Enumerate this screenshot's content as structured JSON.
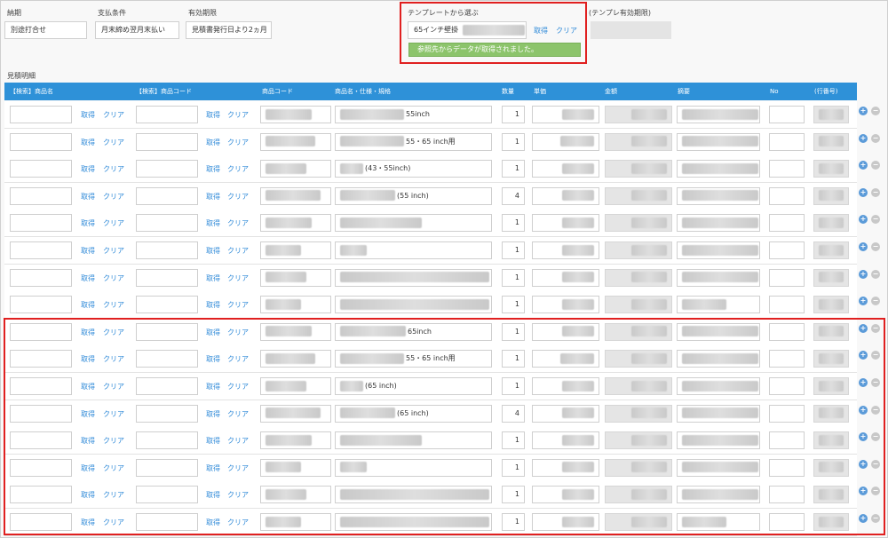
{
  "form": {
    "delivery": {
      "label": "納期",
      "value": "別途打合せ"
    },
    "payment": {
      "label": "支払条件",
      "value": "月末締め翌月末払い"
    },
    "validity": {
      "label": "有効期限",
      "value": "見積書発行日より2ヵ月"
    },
    "template": {
      "label": "テンプレートから選ぶ",
      "value": "65インチ壁掛",
      "get_label": "取得",
      "clear_label": "クリア",
      "success_message": "参照先からデータが取得されました。"
    },
    "template_validity": {
      "label": "(テンプレ有効期限)"
    }
  },
  "section_title": "見積明細",
  "table": {
    "headers": [
      "【検索】商品名",
      "【検索】商品コード",
      "商品コード",
      "商品名・仕様・規格",
      "数量",
      "単価",
      "金額",
      "摘要",
      "No",
      "(行番号)"
    ],
    "link_get": "取得",
    "link_clear": "クリア",
    "rows": [
      {
        "name_suffix": "55inch",
        "qty": "1"
      },
      {
        "name_suffix": "55・65 inch用",
        "qty": "1"
      },
      {
        "name_suffix": "(43・55inch)",
        "qty": "1"
      },
      {
        "name_suffix": "(55 inch)",
        "qty": "4"
      },
      {
        "name_suffix": "",
        "qty": "1"
      },
      {
        "name_suffix": "",
        "qty": "1"
      },
      {
        "name_suffix": "",
        "qty": "1"
      },
      {
        "name_suffix": "",
        "qty": "1"
      },
      {
        "name_suffix": "65inch",
        "qty": "1"
      },
      {
        "name_suffix": "55・65 inch用",
        "qty": "1"
      },
      {
        "name_suffix": "(65 inch)",
        "qty": "1"
      },
      {
        "name_suffix": "(65 inch)",
        "qty": "4"
      },
      {
        "name_suffix": "",
        "qty": "1"
      },
      {
        "name_suffix": "",
        "qty": "1"
      },
      {
        "name_suffix": "",
        "qty": "1"
      },
      {
        "name_suffix": "",
        "qty": "1"
      }
    ]
  },
  "icons": {
    "add": "plus-circle-icon",
    "remove": "minus-circle-icon"
  },
  "colors": {
    "header": "#2e91d8",
    "link": "#2f8ad8",
    "success": "#8cc46b",
    "highlight": "#e02020"
  }
}
